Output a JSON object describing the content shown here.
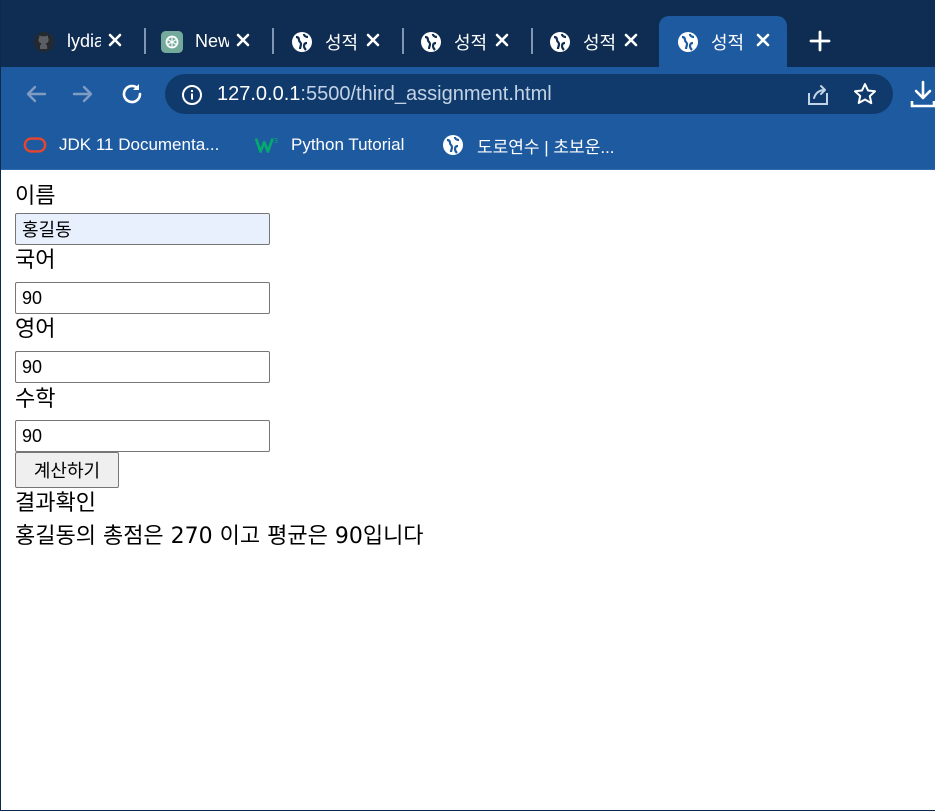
{
  "browser": {
    "tabs": [
      {
        "title": "lydia",
        "icon": "github-icon",
        "active": false
      },
      {
        "title": "New",
        "icon": "openai-icon",
        "active": false
      },
      {
        "title": "성적",
        "icon": "globe-icon",
        "active": false
      },
      {
        "title": "성적",
        "icon": "globe-icon",
        "active": false
      },
      {
        "title": "성적",
        "icon": "globe-icon",
        "active": false
      },
      {
        "title": "성적",
        "icon": "globe-icon",
        "active": true
      }
    ],
    "url_host": "127.0.0.1",
    "url_path": ":5500/third_assignment.html",
    "bookmarks": [
      {
        "label": "JDK 11 Documenta...",
        "icon": "oracle-icon"
      },
      {
        "label": "Python Tutorial",
        "icon": "w3schools-icon"
      },
      {
        "label": "도로연수 | 초보운...",
        "icon": "globe-icon"
      }
    ],
    "colors": {
      "tabstrip": "#0f2d52",
      "toolbar": "#1e5aa0",
      "omnibox": "#103a6b"
    }
  },
  "page": {
    "name_label": "이름",
    "name_value": "홍길동",
    "korean_label": "국어",
    "korean_value": "90",
    "english_label": "영어",
    "english_value": "90",
    "math_label": "수학",
    "math_value": "90",
    "calc_button": "계산하기",
    "result_title": "결과확인",
    "result_text": "홍길동의 총점은 270 이고 평균은 90입니다"
  }
}
